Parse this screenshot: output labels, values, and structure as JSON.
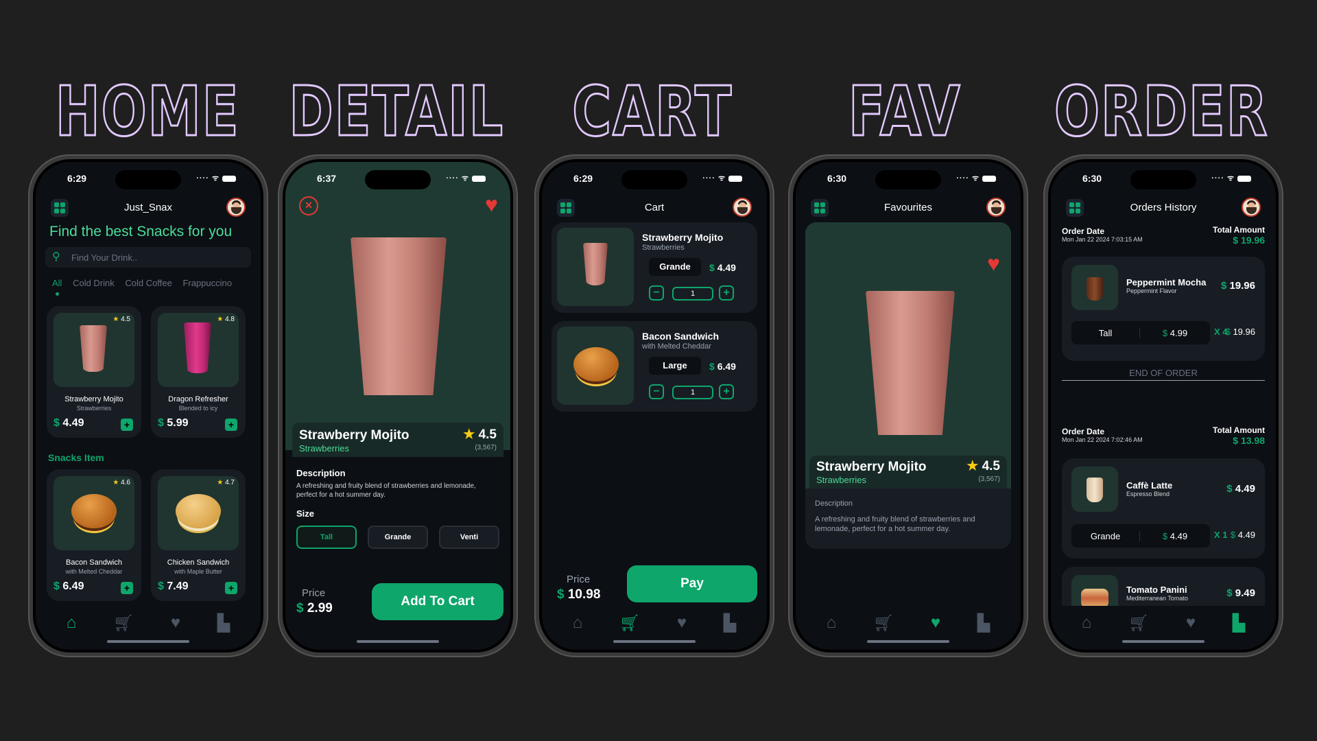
{
  "titles": {
    "home": "HOME",
    "detail": "DETAIL",
    "cart": "CART",
    "fav": "FAV",
    "order": "ORDER"
  },
  "colors": {
    "accent": "#0ea66b",
    "bg": "#0c0f14",
    "card": "#181d24",
    "heart": "#e53935"
  },
  "home": {
    "time": "6:29",
    "app_name": "Just_Snax",
    "headline": "Find the best Snacks for you",
    "search_placeholder": "Find Your Drink..",
    "tabs": [
      "All",
      "Cold Drink",
      "Cold Coffee",
      "Frappuccino"
    ],
    "drinks": [
      {
        "name": "Strawberry Mojito",
        "sub": "Strawberries",
        "rating": "4.5",
        "price": "4.49"
      },
      {
        "name": "Dragon Refresher",
        "sub": "Blended to icy",
        "rating": "4.8",
        "price": "5.99"
      }
    ],
    "snacks_label": "Snacks Item",
    "snacks": [
      {
        "name": "Bacon Sandwich",
        "sub": "with Melted Cheddar",
        "rating": "4.6",
        "price": "6.49"
      },
      {
        "name": "Chicken Sandwich",
        "sub": "with Maple Butter",
        "rating": "4.7",
        "price": "7.49"
      }
    ]
  },
  "detail": {
    "time": "6:37",
    "name": "Strawberry Mojito",
    "sub": "Strawberries",
    "rating": "4.5",
    "count": "(3,567)",
    "desc_label": "Description",
    "desc": "A refreshing and fruity blend of strawberries and lemonade, perfect for a hot summer day.",
    "size_label": "Size",
    "sizes": [
      "Tall",
      "Grande",
      "Venti"
    ],
    "price_label": "Price",
    "price": "2.99",
    "cta": "Add To Cart"
  },
  "cart": {
    "time": "6:29",
    "title": "Cart",
    "items": [
      {
        "name": "Strawberry Mojito",
        "sub": "Strawberries",
        "size": "Grande",
        "price": "4.49",
        "qty": "1"
      },
      {
        "name": "Bacon Sandwich",
        "sub": "with Melted Cheddar",
        "size": "Large",
        "price": "6.49",
        "qty": "1"
      }
    ],
    "price_label": "Price",
    "total": "10.98",
    "pay": "Pay"
  },
  "fav": {
    "time": "6:30",
    "title": "Favourites",
    "name": "Strawberry Mojito",
    "sub": "Strawberries",
    "rating": "4.5",
    "count": "(3,567)",
    "desc_label": "Description",
    "desc": "A refreshing and fruity blend of strawberries and lemonade, perfect for a hot summer day."
  },
  "order": {
    "time": "6:30",
    "title": "Orders History",
    "date_label": "Order Date",
    "total_label": "Total Amount",
    "end_label": "END OF ORDER",
    "orders": [
      {
        "date": "Mon Jan 22 2024 7:03:15 AM",
        "total": "19.96",
        "items": [
          {
            "name": "Peppermint Mocha",
            "sub": "Peppermint Flavor",
            "price": "19.96",
            "size": "Tall",
            "unit": "4.99",
            "qty": "X 4",
            "line": "19.96"
          }
        ]
      },
      {
        "date": "Mon Jan 22 2024 7:02:46 AM",
        "total": "13.98",
        "items": [
          {
            "name": "Caffè Latte",
            "sub": "Espresso Blend",
            "price": "4.49",
            "size": "Grande",
            "unit": "4.49",
            "qty": "X 1",
            "line": "4.49"
          },
          {
            "name": "Tomato Panini",
            "sub": "Mediterranean Tomato",
            "price": "9.49"
          }
        ]
      }
    ]
  }
}
